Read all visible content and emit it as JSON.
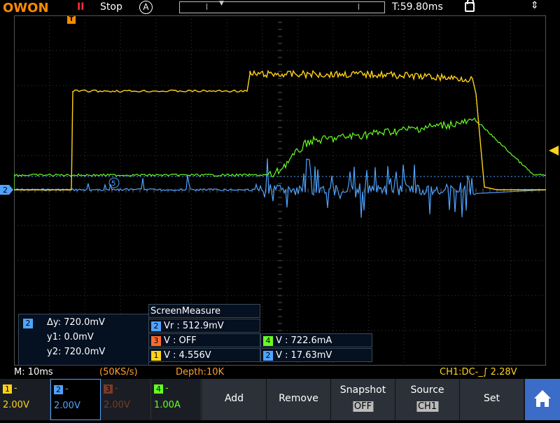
{
  "topbar": {
    "logo": "OWON",
    "pause_symbol": "II",
    "run_state": "Stop",
    "trigger_mode": "A",
    "timebase_pos": "T:59.80ms",
    "usb_symbol": "⇕"
  },
  "markers": {
    "trigger_top": "T",
    "ch2_level": "2",
    "cursor_circle": "5"
  },
  "cursor_readout": {
    "channel": "2",
    "dy": "Δy: 720.0mV",
    "y1": "y1: 0.0mV",
    "y2": "y2: 720.0mV"
  },
  "screen_measure": {
    "title": "ScreenMeasure",
    "rows": [
      {
        "ch": "2",
        "text": "Vr : 512.9mV",
        "color": "#4fa3ff"
      },
      {
        "ch": "3",
        "text": "V : OFF",
        "color": "#ff6a2a"
      },
      {
        "ch": "4",
        "text": "V : 722.6mA",
        "color": "#66ff22"
      },
      {
        "ch": "1",
        "text": "V : 4.556V",
        "color": "#ffd21a"
      },
      {
        "ch": "2",
        "text": "V : 17.63mV",
        "color": "#4fa3ff"
      }
    ]
  },
  "status": {
    "time_div": "M: 10ms",
    "sample_rate": "(50KS/s)",
    "depth": "Depth:10K",
    "trigger": "CH1:DC-_∫ 2.28V"
  },
  "channels": [
    {
      "num": "1",
      "dash": "-",
      "volts": "2.00V",
      "color": "#ffd21a",
      "active": false
    },
    {
      "num": "2",
      "dash": "-",
      "volts": "2.00V",
      "color": "#4fa3ff",
      "active": true
    },
    {
      "num": "3",
      "dash": "-",
      "volts": "2.00V",
      "color": "#7a3a26",
      "active": false
    },
    {
      "num": "4",
      "dash": "-",
      "volts": "1.00A",
      "color": "#66ff22",
      "active": false
    }
  ],
  "menu": {
    "add": "Add",
    "remove": "Remove",
    "snapshot_label": "Snapshot",
    "snapshot_value": "OFF",
    "source_label": "Source",
    "source_value": "CH1",
    "set": "Set",
    "home_icon": "home-icon"
  },
  "colors": {
    "ch1": "#ffd21a",
    "ch2": "#4fa3ff",
    "ch4": "#66ff22",
    "grid": "#3a3a3a",
    "logo": "#ff8a00"
  }
}
